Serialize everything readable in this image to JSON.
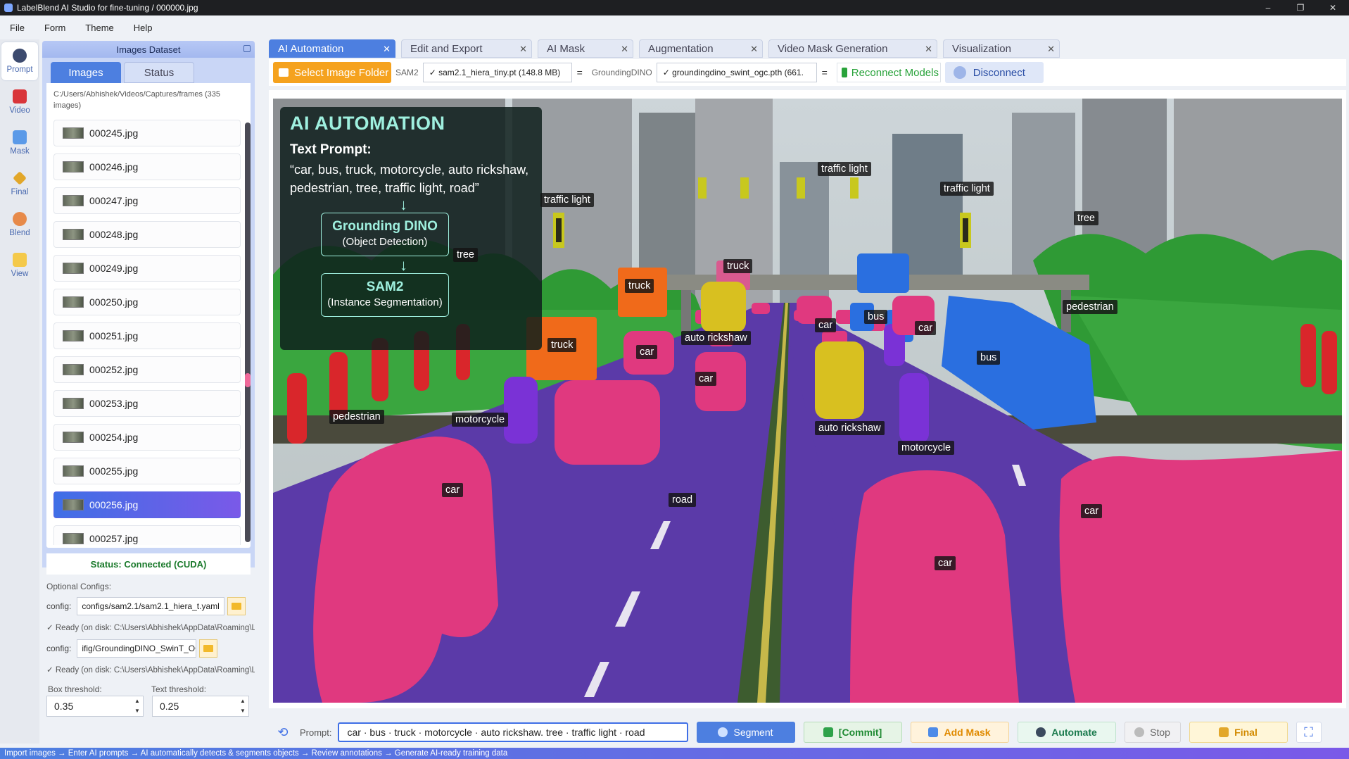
{
  "window": {
    "title": "LabelBlend AI Studio for fine-tuning / 000000.jpg",
    "controls": [
      "–",
      "❐",
      "✕"
    ]
  },
  "menu": [
    "File",
    "Form",
    "Theme",
    "Help"
  ],
  "tools": [
    {
      "label": "Prompt",
      "icon": "prompt-icon",
      "active": true
    },
    {
      "label": "Video",
      "icon": "video-icon"
    },
    {
      "label": "Mask",
      "icon": "mask-icon"
    },
    {
      "label": "Final",
      "icon": "final-icon"
    },
    {
      "label": "Blend",
      "icon": "blend-icon"
    },
    {
      "label": "View",
      "icon": "view-icon"
    }
  ],
  "dataset": {
    "header": "Images Dataset",
    "tabs": [
      "Images",
      "Status"
    ],
    "path": "C:/Users/Abhishek/Videos/Captures/frames  (335 images)",
    "files": [
      "000245.jpg",
      "000246.jpg",
      "000247.jpg",
      "000248.jpg",
      "000249.jpg",
      "000250.jpg",
      "000251.jpg",
      "000252.jpg",
      "000253.jpg",
      "000254.jpg",
      "000255.jpg",
      "000256.jpg",
      "000257.jpg"
    ],
    "selected_file": "000256.jpg",
    "status": "Status: Connected (CUDA)",
    "optional_label": "Optional Configs:",
    "config_label": "config:",
    "sam_config": "configs/sam2.1/sam2.1_hiera_t.yaml",
    "sam_ready": "✓ Ready (on disk: C:\\Users\\Abhishek\\AppData\\Roaming\\LabelBlend\\data\\sam",
    "dino_config": "ifig/GroundingDINO_SwinT_OGC.py",
    "dino_ready": "✓ Ready (on disk: C:\\Users\\Abhishek\\AppData\\Roaming\\LabelBlend\\data\\g",
    "box_threshold_label": "Box threshold:",
    "text_threshold_label": "Text threshold:",
    "box_threshold": "0.35",
    "text_threshold": "0.25"
  },
  "main_tabs": [
    {
      "label": "AI Automation",
      "active": true
    },
    {
      "label": "Edit and Export"
    },
    {
      "label": "AI Mask"
    },
    {
      "label": "Augmentation"
    },
    {
      "label": "Video Mask Generation"
    },
    {
      "label": "Visualization"
    }
  ],
  "toolbar": {
    "select_folder": "Select Image Folder",
    "sam_label": "SAM2",
    "sam_model": "✓  sam2.1_hiera_tiny.pt  (148.8 MB)",
    "dino_label": "GroundingDINO",
    "dino_model": "✓  groundingdino_swint_ogc.pth  (661.",
    "menu_glyph": "=",
    "reconnect": "Reconnect Models",
    "disconnect": "Disconnect"
  },
  "overlay": {
    "title": "AI AUTOMATION",
    "subtitle": "Text Prompt:",
    "prompt_text": "“car, bus, truck, motorcycle, auto rickshaw, pedestrian, tree, traffic light, road”",
    "arrow": "↓",
    "box1_title": "Grounding DINO",
    "box1_sub": "(Object Detection)",
    "box2_title": "SAM2",
    "box2_sub": "(Instance Segmentation)"
  },
  "labels": [
    "traffic light",
    "traffic light",
    "traffic light",
    "tree",
    "tree",
    "truck",
    "truck",
    "truck",
    "pedestrian",
    "pedestrian",
    "car",
    "car",
    "car",
    "car",
    "car",
    "car",
    "car",
    "bus",
    "bus",
    "auto rickshaw",
    "auto rickshaw",
    "motorcycle",
    "motorcycle",
    "road"
  ],
  "prompt": {
    "label": "Prompt:",
    "value": "car · bus · truck · motorcycle · auto rickshaw. tree · traffic light · road",
    "segment": "Segment",
    "commit": "[Commit]",
    "add_mask": "Add Mask",
    "automate": "Automate",
    "stop": "Stop",
    "final": "Final",
    "refresh_glyph": "⟲",
    "full_glyph": "⛶"
  },
  "status_strip": "Import images → Enter AI prompts → AI automatically detects & segments objects → Review annotations → Generate AI-ready training data",
  "colors": {
    "accent": "#4d7fe0",
    "car": "#e0397f",
    "bus": "#2a6fe0",
    "truck": "#f06a1a",
    "auto_rickshaw": "#d8c020",
    "motorcycle": "#7a32d6",
    "pedestrian": "#d9262b",
    "tree": "#2f9a35",
    "road": "#5b3aa8",
    "traffic_light": "#c8c81e"
  }
}
